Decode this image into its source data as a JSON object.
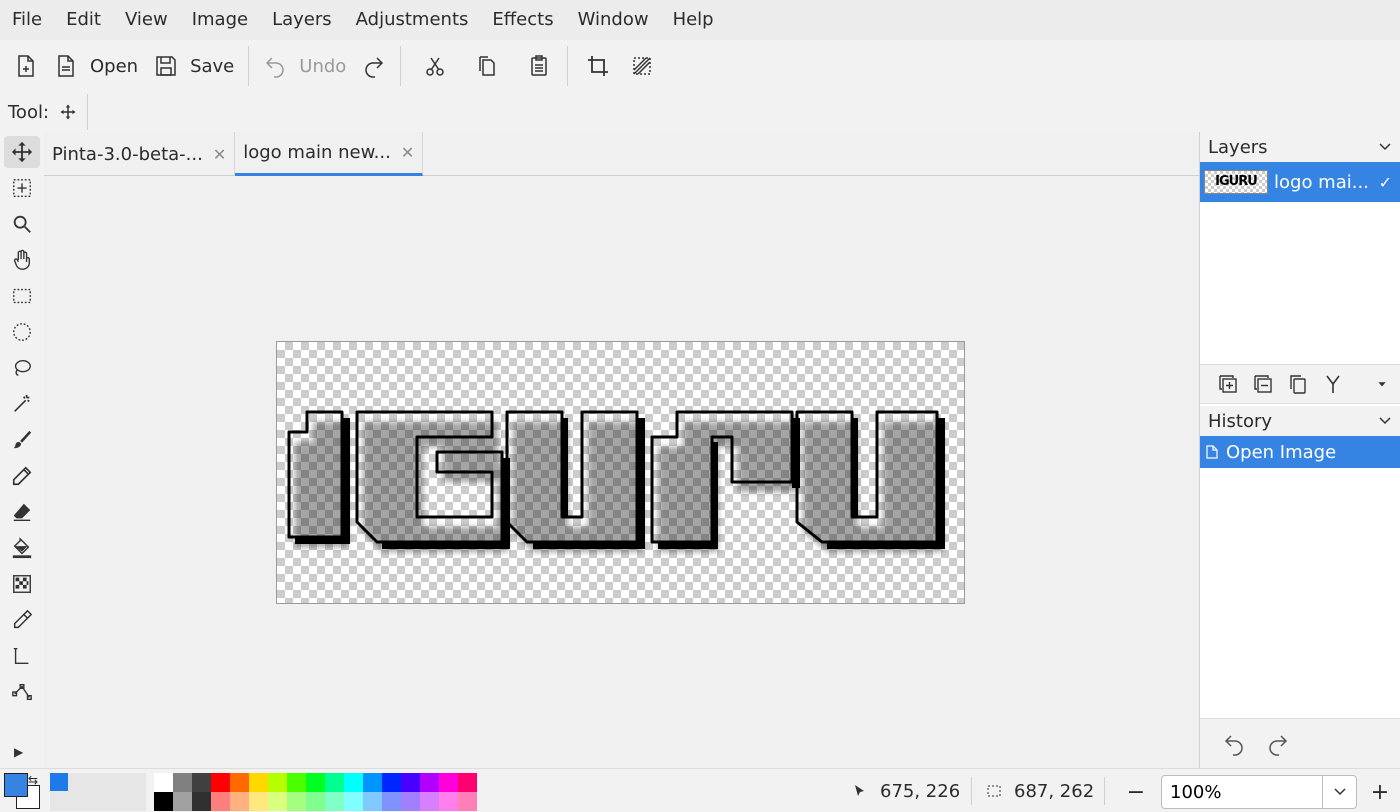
{
  "menu": [
    "File",
    "Edit",
    "View",
    "Image",
    "Layers",
    "Adjustments",
    "Effects",
    "Window",
    "Help"
  ],
  "toolbar": {
    "open_label": "Open",
    "save_label": "Save",
    "undo_label": "Undo"
  },
  "tool_row": {
    "label": "Tool:"
  },
  "tabs": [
    {
      "label": "Pinta-3.0-beta-...",
      "active": false
    },
    {
      "label": "logo main new...",
      "active": true
    }
  ],
  "image": {
    "logo_text": "IGURU"
  },
  "layers_panel": {
    "title": "Layers",
    "layers": [
      {
        "name": "logo mai...",
        "thumb_text": "IGURU",
        "visible": true
      }
    ]
  },
  "history_panel": {
    "title": "History",
    "items": [
      {
        "label": "Open Image"
      }
    ]
  },
  "status": {
    "cursor_pos": "675, 226",
    "selection_size": "687, 262",
    "zoom": "100%"
  },
  "colors": {
    "accent": "#3584e4",
    "primary": "#3584e4",
    "secondary": "#ffffff",
    "palette_top": [
      "#ffffff",
      "#808080",
      "#404040",
      "#ff0000",
      "#ff6a00",
      "#ffd800",
      "#b6ff00",
      "#4cff00",
      "#00ff21",
      "#00ff90",
      "#00ffff",
      "#0094ff",
      "#0026ff",
      "#4800ff",
      "#b200ff",
      "#ff00dc",
      "#ff006e"
    ],
    "palette_bottom": [
      "#000000",
      "#a0a0a0",
      "#303030",
      "#ff7f7f",
      "#ffb27f",
      "#ffe97f",
      "#daff7f",
      "#a5ff7f",
      "#7fff8e",
      "#7fffc5",
      "#7fffff",
      "#7fc9ff",
      "#7f92ff",
      "#a17fff",
      "#d67fff",
      "#ff7fed",
      "#ff7fb6"
    ]
  }
}
